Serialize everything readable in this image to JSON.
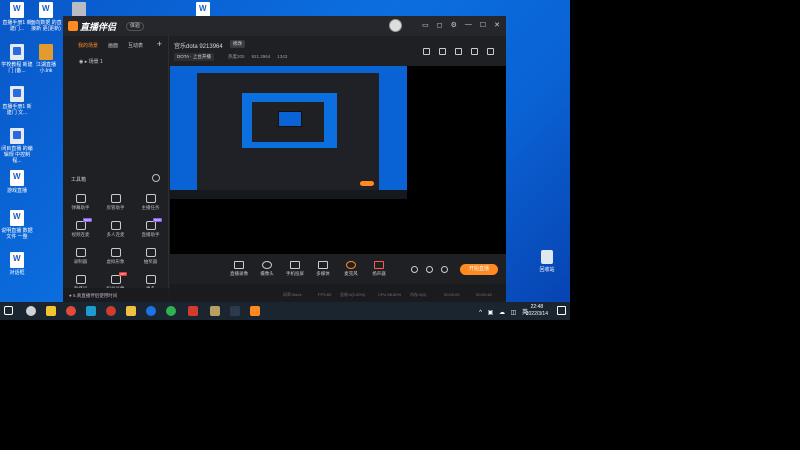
{
  "desktop": {
    "icons": [
      {
        "label": "直播手册1 新建门...",
        "kind": "word"
      },
      {
        "label": "面向数据 的直接新 更(更新)",
        "kind": "word"
      },
      {
        "label": "",
        "kind": "gray"
      },
      {
        "label": "",
        "kind": "word"
      },
      {
        "label": "学校教程 新建门 (备...",
        "kind": "wps"
      },
      {
        "label": "江湖直播 小.lnk",
        "kind": "folder"
      },
      {
        "label": "直播手册1 新建门 文...",
        "kind": "wps"
      },
      {
        "label": "闭目直播 的编辑规 中控制程...",
        "kind": "wps"
      },
      {
        "label": "游戏直播",
        "kind": "word"
      },
      {
        "label": "说明直播 数据文件 一整",
        "kind": "word"
      },
      {
        "label": "对话框",
        "kind": "word"
      }
    ],
    "recycle_label": "回收站"
  },
  "app": {
    "logo": "直播伴侣",
    "version": "体验",
    "left": {
      "tabs": [
        "我的场景",
        "画面",
        "互动表"
      ],
      "add": "+",
      "scene": "场景 1",
      "tools_title": "工具箱",
      "tools": [
        {
          "label": "弹幕助手",
          "badge": ""
        },
        {
          "label": "房管助手",
          "badge": ""
        },
        {
          "label": "主播任务",
          "badge": ""
        },
        {
          "label": "视频连麦",
          "badge": "NEW"
        },
        {
          "label": "多人连麦",
          "badge": ""
        },
        {
          "label": "直播助手",
          "badge": "NEW"
        },
        {
          "label": "录制器",
          "badge": ""
        },
        {
          "label": "虚拟形象",
          "badge": ""
        },
        {
          "label": "抽奖器",
          "badge": ""
        },
        {
          "label": "直播间",
          "badge": ""
        },
        {
          "label": "粉丝画像",
          "badge": "HOT"
        },
        {
          "label": "更多",
          "badge": ""
        }
      ],
      "notice": "5.真直播伴侣使用时间"
    },
    "room": {
      "name": "宫乐dota 9213964",
      "edit": "修改",
      "category": "DOTA · 上台开播",
      "stats": [
        "热度200",
        "921.3964",
        "1343"
      ]
    },
    "controls": [
      {
        "label": "直播录像"
      },
      {
        "label": "摄像头"
      },
      {
        "label": "手机投屏"
      },
      {
        "label": "多媒体"
      },
      {
        "label": "麦克风"
      },
      {
        "label": "扬声器"
      }
    ],
    "go_live": "开始直播",
    "status": {
      "bitrate": "码率:0kb/s",
      "fps": "FPS:60",
      "dropped": "丢帧:0(0.00%)",
      "cpu": "CPU:98.80%",
      "mem": "内存:0(0)",
      "live_time": "00:00:00",
      "rec_time": "00:00:48"
    }
  },
  "taskbar": {
    "time": "22:48",
    "date": "2022/3/14",
    "tray": "^ ▣ ☁ ◫ 英"
  }
}
